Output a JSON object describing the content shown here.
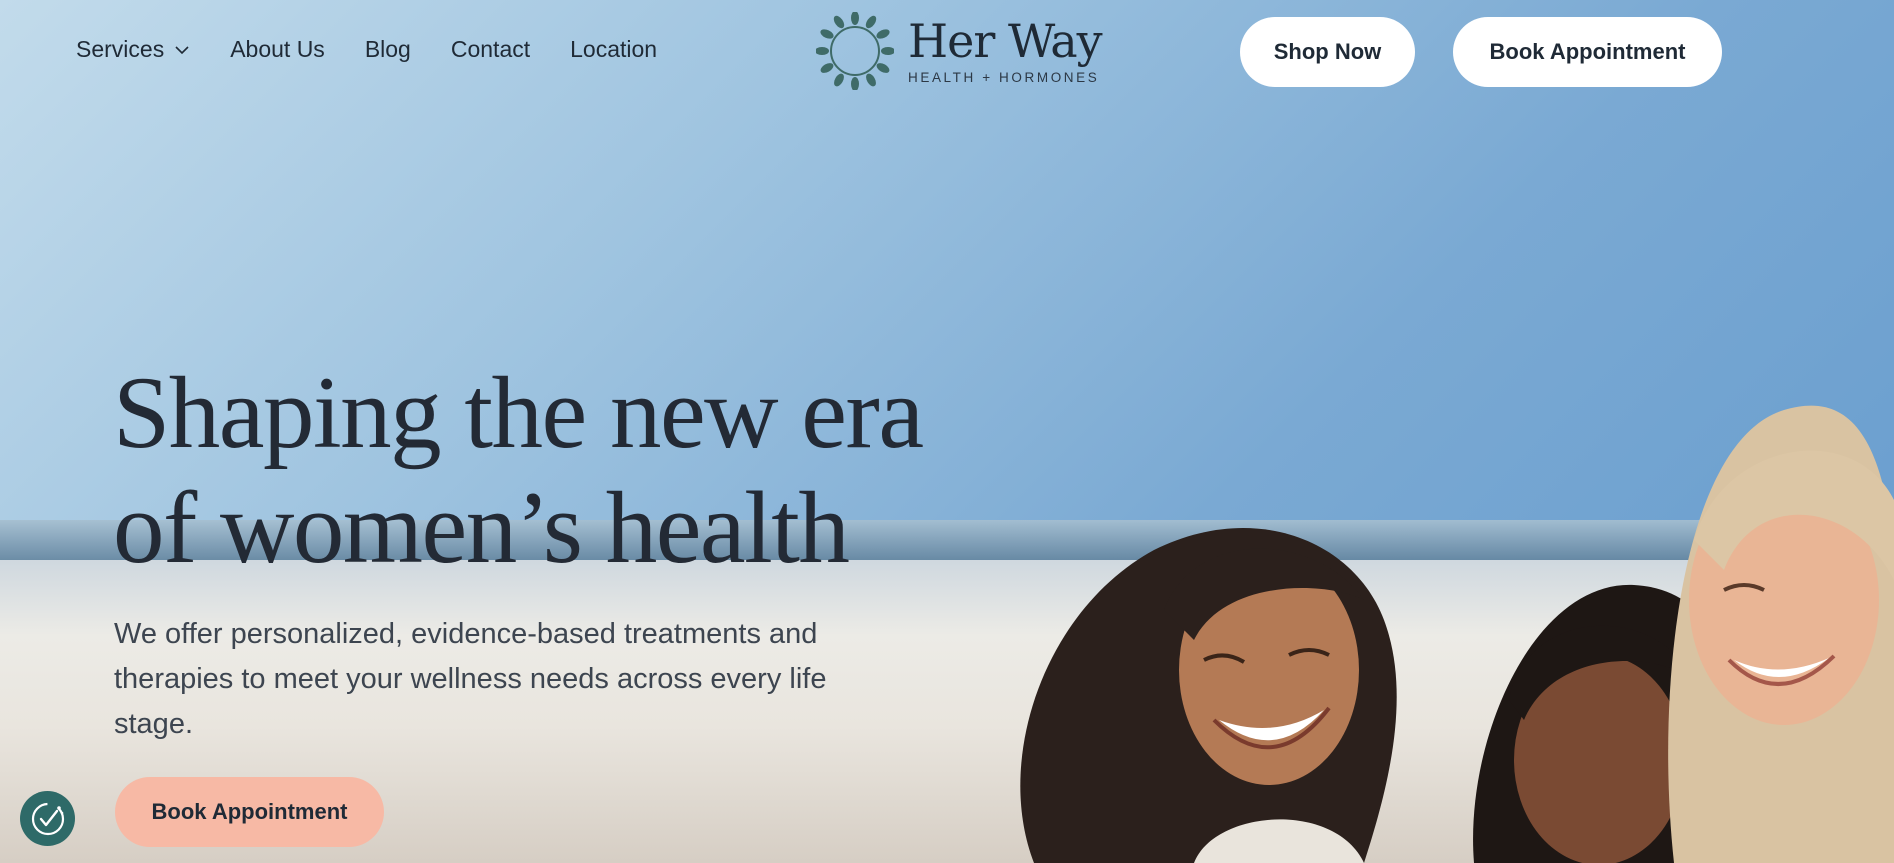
{
  "nav": {
    "items": [
      {
        "label": "Services",
        "has_dropdown": true
      },
      {
        "label": "About Us"
      },
      {
        "label": "Blog"
      },
      {
        "label": "Contact"
      },
      {
        "label": "Location"
      }
    ]
  },
  "logo": {
    "title": "Her Way",
    "subtitle": "HEALTH + HORMONES",
    "icon": "laurel-wreath-icon"
  },
  "header_buttons": {
    "shop": "Shop Now",
    "book": "Book Appointment"
  },
  "hero": {
    "headline_line1": "Shaping the new era",
    "headline_line2": "of women’s health",
    "subtext": "We offer personalized, evidence-based treatments and therapies to meet your wellness needs across every life stage.",
    "cta": "Book Appointment"
  },
  "colors": {
    "text": "#232a35",
    "cta_bg": "#f7b9a5",
    "logo_green": "#3f6b68",
    "cookie_bg": "#2e6a68"
  },
  "icons": {
    "chevron": "chevron-down-icon",
    "cookie": "cookie-consent-icon"
  }
}
